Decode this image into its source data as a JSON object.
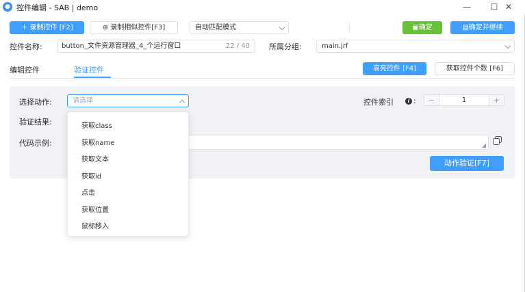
{
  "window": {
    "title": "控件编辑 - SAB | demo",
    "app_icon": "chat-bubble-icon",
    "min_glyph": "—",
    "max_glyph": "☐",
    "close_glyph": "✕"
  },
  "toolbar": {
    "record_label": "录制控件 [F2]",
    "record_similar_label": "录制相似控件[F3]",
    "mode_select_value": "自动匹配模式",
    "confirm_label": "确定",
    "confirm_continue_label": "确定并继续"
  },
  "form": {
    "name_label": "控件名称:",
    "name_value": "button_文件资源管理器_4_个运行窗口",
    "name_counter": "22 / 40",
    "group_label": "所属分组:",
    "group_value": "main.jrf"
  },
  "tabs": [
    {
      "label": "编辑控件"
    },
    {
      "label": "验证控件"
    }
  ],
  "tab_actions": {
    "highlight_label": "高亮控件 [F4]",
    "count_label": "获取控件个数 [F6]"
  },
  "verify": {
    "action_label": "选择动作:",
    "action_placeholder": "请选择",
    "result_label": "验证结果:",
    "code_label": "代码示例:",
    "index_label": "控件索引",
    "index_value": "1",
    "verify_button": "动作验证[F7]"
  },
  "dropdown": {
    "options": [
      "获取class",
      "获取name",
      "获取文本",
      "获取id",
      "点击",
      "获取位置",
      "鼠标移入"
    ]
  },
  "colors": {
    "primary": "#409eff",
    "success": "#67c23a"
  }
}
